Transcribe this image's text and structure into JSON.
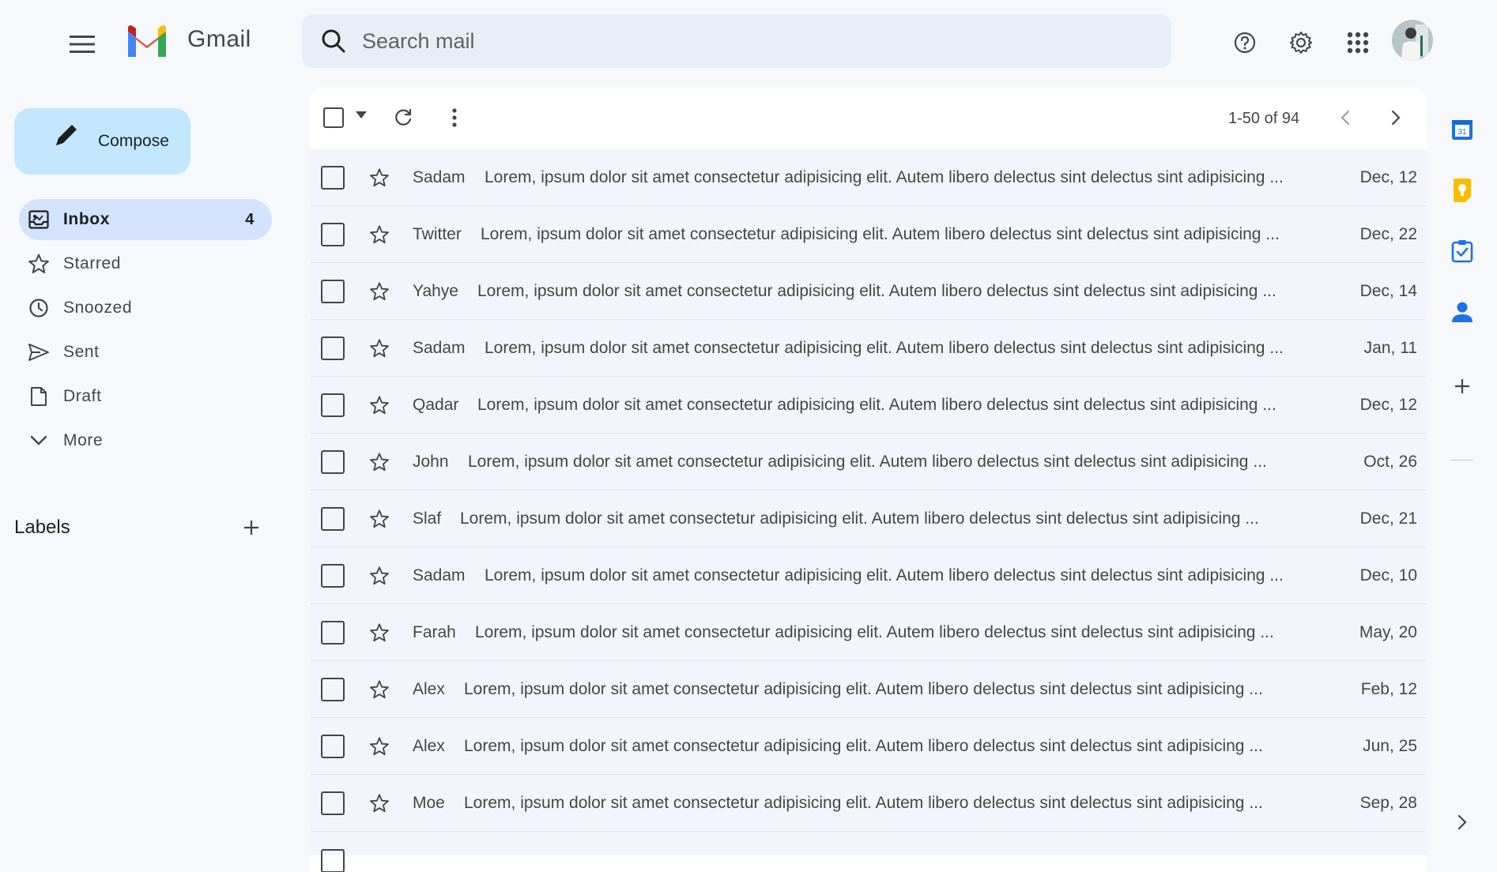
{
  "header": {
    "brand": "Gmail",
    "search_placeholder": "Search mail"
  },
  "compose_label": "Compose",
  "nav": [
    {
      "label": "Inbox",
      "icon": "inbox-icon",
      "count": "4",
      "active": true
    },
    {
      "label": "Starred",
      "icon": "star-icon",
      "count": ""
    },
    {
      "label": "Snoozed",
      "icon": "clock-icon",
      "count": ""
    },
    {
      "label": "Sent",
      "icon": "send-icon",
      "count": ""
    },
    {
      "label": "Draft",
      "icon": "draft-icon",
      "count": ""
    },
    {
      "label": "More",
      "icon": "chevron-down-icon",
      "count": ""
    }
  ],
  "labels_title": "Labels",
  "pager": "1-50 of 94",
  "emails": [
    {
      "sender": "Sadam",
      "snippet": "Lorem, ipsum dolor sit amet consectetur adipisicing elit. Autem libero delectus sint delectus sint adipisicing ...",
      "date": "Dec, 12"
    },
    {
      "sender": "Twitter",
      "snippet": "Lorem, ipsum dolor sit amet consectetur adipisicing elit. Autem libero delectus sint delectus sint adipisicing ...",
      "date": "Dec, 22"
    },
    {
      "sender": "Yahye",
      "snippet": "Lorem, ipsum dolor sit amet consectetur adipisicing elit. Autem libero delectus sint delectus sint adipisicing ...",
      "date": "Dec, 14"
    },
    {
      "sender": "Sadam",
      "snippet": "Lorem, ipsum dolor sit amet consectetur adipisicing elit. Autem libero delectus sint delectus sint adipisicing ...",
      "date": "Jan, 11"
    },
    {
      "sender": "Qadar",
      "snippet": "Lorem, ipsum dolor sit amet consectetur adipisicing elit. Autem libero delectus sint delectus sint adipisicing ...",
      "date": "Dec, 12"
    },
    {
      "sender": "John",
      "snippet": "Lorem, ipsum dolor sit amet consectetur adipisicing elit. Autem libero delectus sint delectus sint adipisicing ...",
      "date": "Oct, 26"
    },
    {
      "sender": "Slaf",
      "snippet": "Lorem, ipsum dolor sit amet consectetur adipisicing elit. Autem libero delectus sint delectus sint adipisicing ...",
      "date": "Dec, 21"
    },
    {
      "sender": "Sadam",
      "snippet": "Lorem, ipsum dolor sit amet consectetur adipisicing elit. Autem libero delectus sint delectus sint adipisicing ...",
      "date": "Dec, 10"
    },
    {
      "sender": "Farah",
      "snippet": "Lorem, ipsum dolor sit amet consectetur adipisicing elit. Autem libero delectus sint delectus sint adipisicing ...",
      "date": "May, 20"
    },
    {
      "sender": "Alex",
      "snippet": "Lorem, ipsum dolor sit amet consectetur adipisicing elit. Autem libero delectus sint delectus sint adipisicing ...",
      "date": "Feb, 12"
    },
    {
      "sender": "Alex",
      "snippet": "Lorem, ipsum dolor sit amet consectetur adipisicing elit. Autem libero delectus sint delectus sint adipisicing ...",
      "date": "Jun, 25"
    },
    {
      "sender": "Moe",
      "snippet": "Lorem, ipsum dolor sit amet consectetur adipisicing elit. Autem libero delectus sint delectus sint adipisicing ...",
      "date": "Sep, 28"
    }
  ],
  "colors": {
    "background": "#f6f8fc",
    "compose": "#c2e7ff",
    "active_nav": "#d3e3fd",
    "search": "#e9eef6",
    "row": "#f2f6fc"
  },
  "side_icons": [
    "calendar-icon",
    "keep-icon",
    "tasks-icon",
    "contacts-icon",
    "add-icon"
  ]
}
